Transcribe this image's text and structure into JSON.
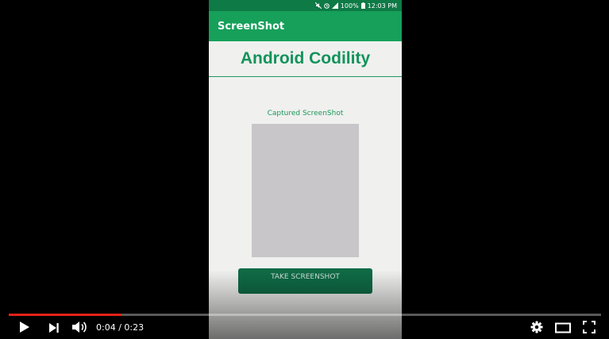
{
  "status_bar": {
    "battery": "100%",
    "time": "12:03 PM"
  },
  "app": {
    "title": "ScreenShot",
    "heading": "Android Codility",
    "caption": "Captured ScreenShot",
    "button_label": "TAKE SCREENSHOT"
  },
  "player": {
    "current_time": "0:04",
    "separator": " / ",
    "duration": "0:23",
    "progress_fraction": 0.19
  },
  "colors": {
    "app_bar": "#16a05a",
    "accent": "#12935a",
    "progress": "#e62117"
  },
  "icons": [
    "mute-icon",
    "alarm-icon",
    "signal-icon",
    "battery-icon",
    "play-icon",
    "next-icon",
    "volume-icon",
    "settings-icon",
    "theater-icon",
    "fullscreen-icon"
  ]
}
